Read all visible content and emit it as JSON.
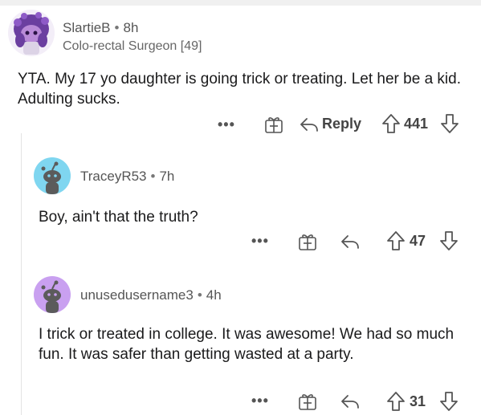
{
  "comments": [
    {
      "username": "SlartieB",
      "time": "8h",
      "flair": "Colo-rectal Surgeon [49]",
      "body": "YTA. My 17 yo daughter is going trick or treating. Let her be a kid. Adulting sucks.",
      "reply_label": "Reply",
      "votes": "441",
      "more": "•••"
    },
    {
      "username": "TraceyR53",
      "time": "7h",
      "body": "Boy, ain't that the truth?",
      "votes": "47",
      "more": "•••"
    },
    {
      "username": "unusedusername3",
      "time": "4h",
      "body": "I trick or treated in college. It was awesome! We had so much fun. It was safer than getting wasted at a party.",
      "votes": "31",
      "more": "•••"
    }
  ],
  "separator": "•",
  "icons": [
    "more-icon",
    "award-icon",
    "reply-icon",
    "upvote-icon",
    "downvote-icon"
  ],
  "colors": {
    "avatar2": "#7fd6f0",
    "avatar3": "#c9a0f0",
    "avatar1": "#6b3fa0"
  }
}
